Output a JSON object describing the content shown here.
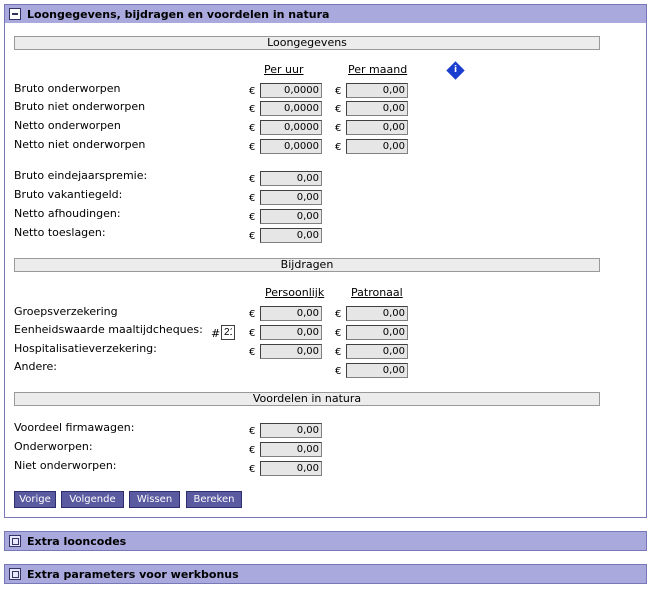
{
  "main_panel": {
    "title": "Loongegevens, bijdragen en voordelen in natura"
  },
  "loongegevens": {
    "section_title": "Loongegevens",
    "col_per_uur": "Per uur",
    "col_per_maand": "Per maand",
    "info_icon": "i",
    "currency": "€",
    "rows": [
      {
        "label": "Bruto onderworpen",
        "per_uur": "0,0000",
        "per_maand": "0,00"
      },
      {
        "label": "Bruto niet onderworpen",
        "per_uur": "0,0000",
        "per_maand": "0,00"
      },
      {
        "label": "Netto onderworpen",
        "per_uur": "0,0000",
        "per_maand": "0,00"
      },
      {
        "label": "Netto niet onderworpen",
        "per_uur": "0,0000",
        "per_maand": "0,00"
      }
    ],
    "single_rows": [
      {
        "label": "Bruto eindejaarspremie:",
        "value": "0,00"
      },
      {
        "label": "Bruto vakantiegeld:",
        "value": "0,00"
      },
      {
        "label": "Netto afhoudingen:",
        "value": "0,00"
      },
      {
        "label": "Netto toeslagen:",
        "value": "0,00"
      }
    ]
  },
  "bijdragen": {
    "section_title": "Bijdragen",
    "col_persoonlijk": "Persoonlijk",
    "col_patronaal": "Patronaal",
    "rows": [
      {
        "label": "Groepsverzekering",
        "persoonlijk": "0,00",
        "patronaal": "0,00"
      },
      {
        "label": "Eenheidswaarde maaltijdcheques:",
        "count_prefix": "#",
        "count": "21",
        "persoonlijk": "0,00",
        "patronaal": "0,00"
      },
      {
        "label": "Hospitalisatieverzekering:",
        "persoonlijk": "0,00",
        "patronaal": "0,00"
      },
      {
        "label": "Andere:",
        "patronaal": "0,00"
      }
    ]
  },
  "voordelen": {
    "section_title": "Voordelen in natura",
    "rows": [
      {
        "label": "Voordeel firmawagen:",
        "value": "0,00"
      },
      {
        "label": "Onderworpen:",
        "value": "0,00"
      },
      {
        "label": "Niet onderworpen:",
        "value": "0,00"
      }
    ]
  },
  "buttons": {
    "vorige": "Vorige",
    "volgende": "Volgende",
    "wissen": "Wissen",
    "bereken": "Bereken"
  },
  "collapsed_panels": [
    {
      "title": "Extra looncodes"
    },
    {
      "title": "Extra parameters voor werkbonus"
    }
  ]
}
